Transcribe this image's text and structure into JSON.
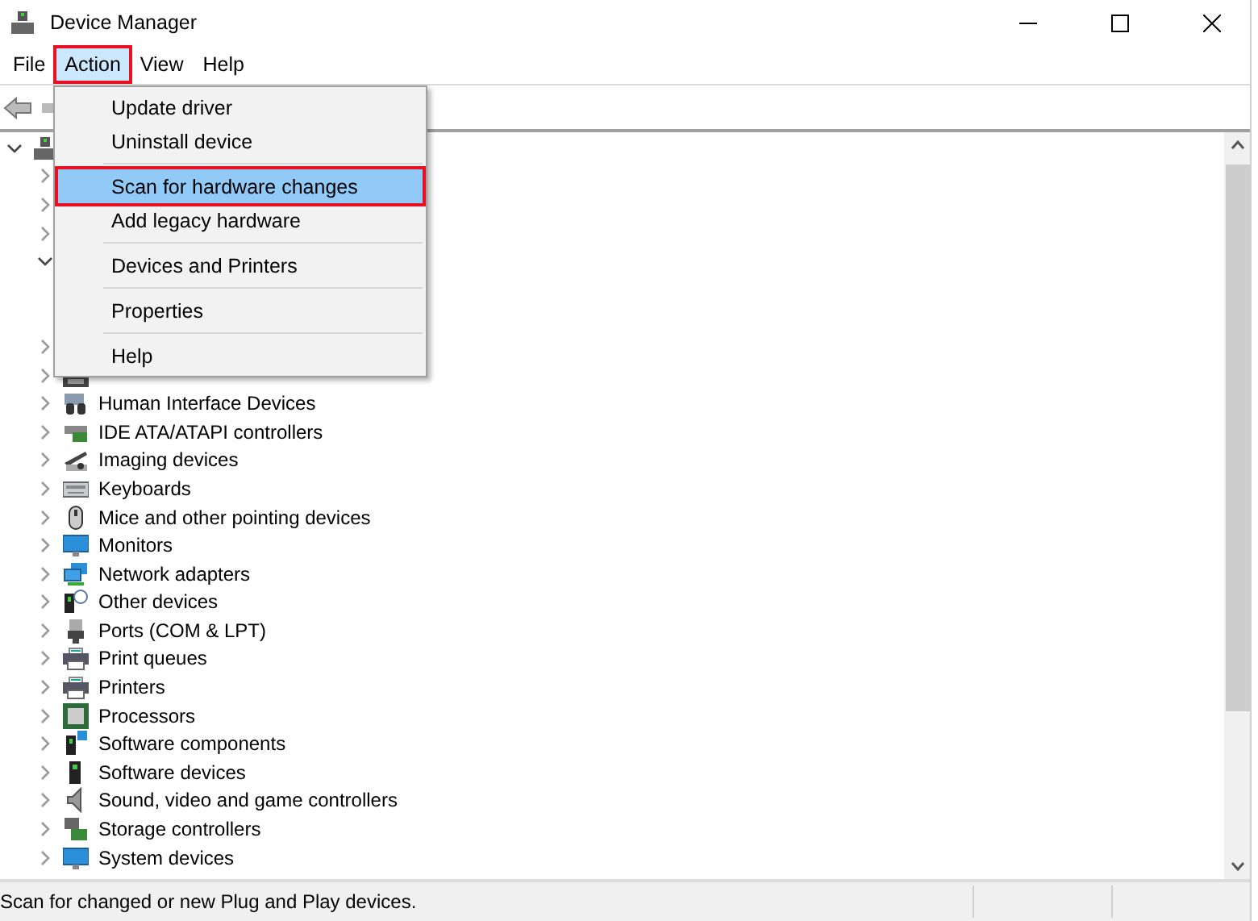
{
  "window": {
    "title": "Device Manager"
  },
  "menubar": [
    {
      "label": "File",
      "selected": false,
      "annotated": false
    },
    {
      "label": "Action",
      "selected": true,
      "annotated": true
    },
    {
      "label": "View",
      "selected": false,
      "annotated": false
    },
    {
      "label": "Help",
      "selected": false,
      "annotated": false
    }
  ],
  "action_menu": {
    "items": [
      {
        "label": "Update driver",
        "selected": false,
        "annotated": false,
        "separator_after": false
      },
      {
        "label": "Uninstall device",
        "selected": false,
        "annotated": false,
        "separator_after": true
      },
      {
        "label": "Scan for hardware changes",
        "selected": true,
        "annotated": true,
        "separator_after": false
      },
      {
        "label": "Add legacy hardware",
        "selected": false,
        "annotated": false,
        "separator_after": true
      },
      {
        "label": "Devices and Printers",
        "selected": false,
        "annotated": false,
        "separator_after": true
      },
      {
        "label": "Properties",
        "selected": false,
        "annotated": false,
        "separator_after": true
      },
      {
        "label": "Help",
        "selected": false,
        "annotated": false,
        "separator_after": false
      }
    ]
  },
  "tree": {
    "root": {
      "kind": "computer",
      "expanded": true,
      "children": [
        {
          "kind": "hidden",
          "expanded": false
        },
        {
          "kind": "hidden",
          "expanded": false
        },
        {
          "kind": "hidden",
          "expanded": false
        },
        {
          "kind": "hidden",
          "expanded": true
        },
        {
          "kind": "hidden",
          "expanded": false
        },
        {
          "kind": "chip",
          "expanded": false
        },
        {
          "label": "Human Interface Devices",
          "kind": "hid",
          "expanded": false
        },
        {
          "label": "IDE ATA/ATAPI controllers",
          "kind": "disk",
          "expanded": false
        },
        {
          "label": "Imaging devices",
          "kind": "camera",
          "expanded": false
        },
        {
          "label": "Keyboards",
          "kind": "keyboard",
          "expanded": false
        },
        {
          "label": "Mice and other pointing devices",
          "kind": "mouse",
          "expanded": false
        },
        {
          "label": "Monitors",
          "kind": "monitor",
          "expanded": false
        },
        {
          "label": "Network adapters",
          "kind": "network",
          "expanded": false
        },
        {
          "label": "Other devices",
          "kind": "unknown",
          "expanded": false
        },
        {
          "label": "Ports (COM & LPT)",
          "kind": "port",
          "expanded": false
        },
        {
          "label": "Print queues",
          "kind": "printer",
          "expanded": false
        },
        {
          "label": "Printers",
          "kind": "printer",
          "expanded": false
        },
        {
          "label": "Processors",
          "kind": "processor",
          "expanded": false
        },
        {
          "label": "Software components",
          "kind": "component",
          "expanded": false
        },
        {
          "label": "Software devices",
          "kind": "tower",
          "expanded": false
        },
        {
          "label": "Sound, video and game controllers",
          "kind": "speaker",
          "expanded": false
        },
        {
          "label": "Storage controllers",
          "kind": "storage",
          "expanded": false
        },
        {
          "label": "System devices",
          "kind": "monitor",
          "expanded": false
        }
      ]
    }
  },
  "status_bar": {
    "text": "Scan for changed or new Plug and Play devices."
  }
}
